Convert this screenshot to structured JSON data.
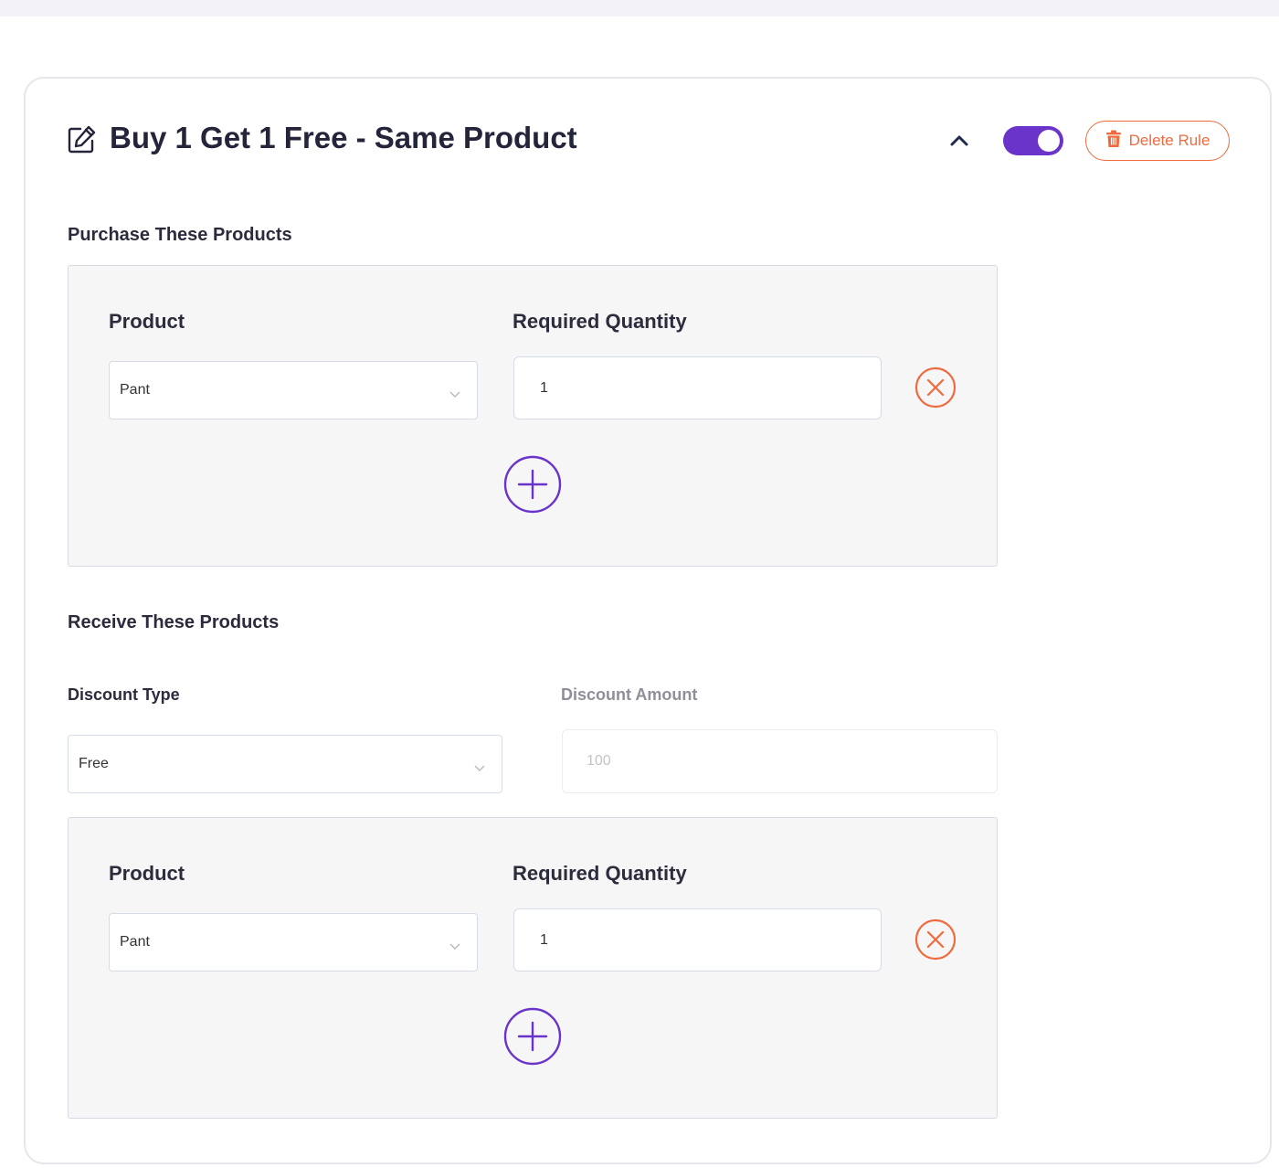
{
  "rule": {
    "title": "Buy 1 Get 1 Free - Same Product",
    "enabled": true,
    "delete_label": "Delete Rule"
  },
  "purchase": {
    "section_label": "Purchase These Products",
    "product_label": "Product",
    "quantity_label": "Required Quantity",
    "rows": [
      {
        "product": "Pant",
        "quantity": "1"
      }
    ]
  },
  "receive": {
    "section_label": "Receive These Products",
    "discount_type_label": "Discount Type",
    "discount_type_value": "Free",
    "discount_amount_label": "Discount Amount",
    "discount_amount_placeholder": "100",
    "product_label": "Product",
    "quantity_label": "Required Quantity",
    "rows": [
      {
        "product": "Pant",
        "quantity": "1"
      }
    ]
  },
  "colors": {
    "accent": "#6a33c9",
    "danger": "#ef6a3d"
  },
  "icons": {
    "edit": "edit-icon",
    "collapse": "chevron-up-icon",
    "delete": "trash-icon",
    "remove": "close-circle-icon",
    "add": "plus-circle-icon"
  }
}
